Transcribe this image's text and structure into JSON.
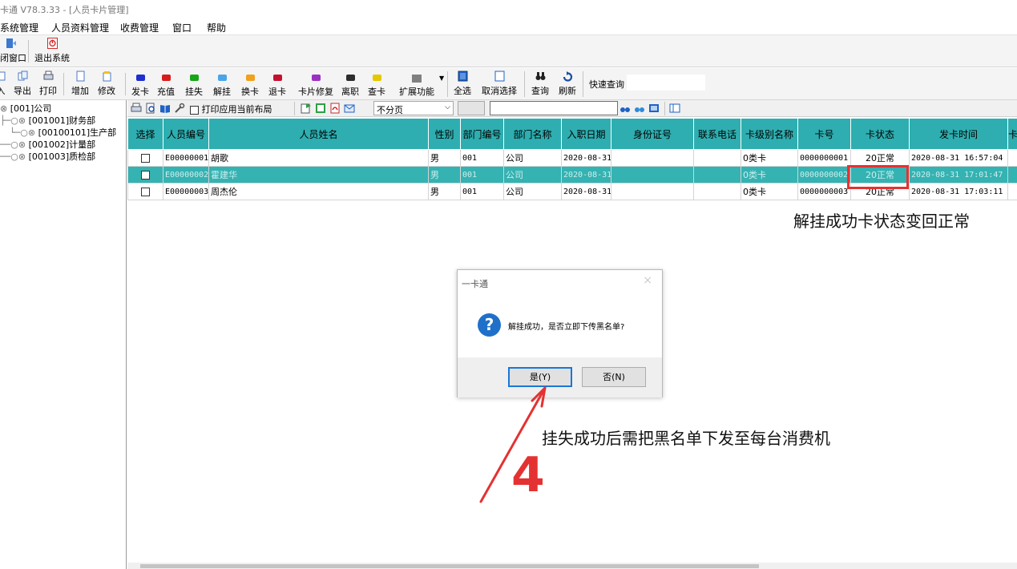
{
  "window": {
    "title": "卡通 V78.3.33 - [人员卡片管理]"
  },
  "menu": [
    "系统管理",
    "人员资料管理",
    "收费管理",
    "窗口",
    "帮助"
  ],
  "toolbar_top": [
    {
      "label": "闭窗口",
      "icon": "door-icon"
    },
    {
      "label": "退出系统",
      "icon": "exit-icon"
    }
  ],
  "toolbar_main": [
    {
      "label": "入",
      "icon": "import-icon"
    },
    {
      "label": "导出",
      "icon": "export-icon"
    },
    {
      "label": "打印",
      "icon": "print-icon"
    },
    {
      "label": "增加",
      "icon": "add-icon"
    },
    {
      "label": "修改",
      "icon": "edit-icon"
    }
  ],
  "toolbar_card": [
    {
      "label": "发卡",
      "color": "#1d2fd1"
    },
    {
      "label": "充值",
      "color": "#d81c1c"
    },
    {
      "label": "挂失",
      "color": "#17a617"
    },
    {
      "label": "解挂",
      "color": "#4aa5e8"
    },
    {
      "label": "换卡",
      "color": "#f0a11d"
    },
    {
      "label": "退卡",
      "color": "#c4122e"
    },
    {
      "label": "卡片修复",
      "color": "#9b31c2"
    },
    {
      "label": "离职",
      "color": "#2d2d2d"
    },
    {
      "label": "查卡",
      "color": "#e4c800"
    },
    {
      "label": "扩展功能",
      "color": "#7f7f7f"
    }
  ],
  "toolbar_select": [
    {
      "label": "全选",
      "icon": "select-all-icon"
    },
    {
      "label": "取消选择",
      "icon": "deselect-icon"
    },
    {
      "label": "查询",
      "icon": "binoculars-icon"
    },
    {
      "label": "刷新",
      "icon": "refresh-icon"
    }
  ],
  "quick_search": {
    "label": "快速查询",
    "value": ""
  },
  "tree": [
    "[001]公司",
    "[001001]财务部",
    "[00100101]生产部",
    "[001002]计量部",
    "[001003]质检部"
  ],
  "grid_toolbar": {
    "print_layout_label": "打印应用当前布局",
    "paging_value": "不分页",
    "search_value": ""
  },
  "table": {
    "columns": [
      "选择",
      "人员编号",
      "人员姓名",
      "性别",
      "部门编号",
      "部门名称",
      "入职日期",
      "身份证号",
      "联系电话",
      "卡级别名称",
      "卡号",
      "卡状态",
      "发卡时间",
      "卡"
    ],
    "rows": [
      [
        "",
        "E00000001",
        "胡歌",
        "男",
        "001",
        "公司",
        "2020-08-31",
        "",
        "",
        "0类卡",
        "0000000001",
        "20正常",
        "2020-08-31 16:57:04",
        ""
      ],
      [
        "",
        "E00000002",
        "霍建华",
        "男",
        "001",
        "公司",
        "2020-08-31",
        "",
        "",
        "0类卡",
        "0000000002",
        "20正常",
        "2020-08-31 17:01:47",
        ""
      ],
      [
        "",
        "E00000003",
        "周杰伦",
        "男",
        "001",
        "公司",
        "2020-08-31",
        "",
        "",
        "0类卡",
        "0000000003",
        "20正常",
        "2020-08-31 17:03:11",
        ""
      ]
    ],
    "selected_row": 1
  },
  "dialog": {
    "title": "一卡通",
    "close": "×",
    "icon": "question-icon",
    "icon_glyph": "?",
    "message": "解挂成功，是否立即下传黑名单?",
    "yes": "是(Y)",
    "no": "否(N)"
  },
  "annotations": {
    "status_note": "解挂成功卡状态变回正常",
    "blacklist_note": "挂失成功后需把黑名单下发至每台消费机",
    "step_number": "4",
    "highlight_color": "#e43232"
  }
}
